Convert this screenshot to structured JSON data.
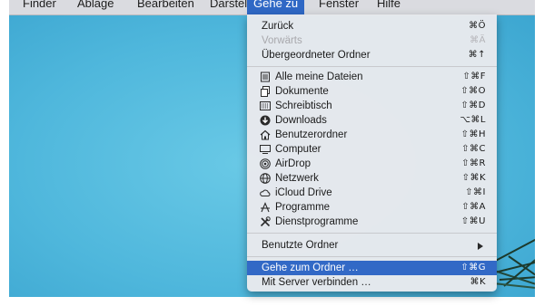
{
  "menubar": {
    "items": [
      {
        "label": "Finder"
      },
      {
        "label": "Ablage"
      },
      {
        "label": "Bearbeiten"
      },
      {
        "label": "Darstellung"
      },
      {
        "label": "Gehe zu"
      },
      {
        "label": "Fenster"
      },
      {
        "label": "Hilfe"
      }
    ],
    "active_index": 4
  },
  "menu": {
    "items": [
      {
        "label": "Zurück",
        "shortcut": "⌘Ö",
        "enabled": true
      },
      {
        "label": "Vorwärts",
        "shortcut": "⌘Ä",
        "enabled": false
      },
      {
        "label": "Übergeordneter Ordner",
        "shortcut": "⌘↑",
        "enabled": true
      },
      {
        "label": "Alle meine Dateien",
        "shortcut": "⇧⌘F",
        "icon": "all-files-icon",
        "enabled": true
      },
      {
        "label": "Dokumente",
        "shortcut": "⇧⌘O",
        "icon": "documents-icon",
        "enabled": true
      },
      {
        "label": "Schreibtisch",
        "shortcut": "⇧⌘D",
        "icon": "desktop-icon",
        "enabled": true
      },
      {
        "label": "Downloads",
        "shortcut": "⌥⌘L",
        "icon": "downloads-icon",
        "enabled": true
      },
      {
        "label": "Benutzerordner",
        "shortcut": "⇧⌘H",
        "icon": "home-icon",
        "enabled": true
      },
      {
        "label": "Computer",
        "shortcut": "⇧⌘C",
        "icon": "computer-icon",
        "enabled": true
      },
      {
        "label": "AirDrop",
        "shortcut": "⇧⌘R",
        "icon": "airdrop-icon",
        "enabled": true
      },
      {
        "label": "Netzwerk",
        "shortcut": "⇧⌘K",
        "icon": "network-icon",
        "enabled": true
      },
      {
        "label": "iCloud Drive",
        "shortcut": "⇧⌘I",
        "icon": "icloud-icon",
        "enabled": true
      },
      {
        "label": "Programme",
        "shortcut": "⇧⌘A",
        "icon": "applications-icon",
        "enabled": true
      },
      {
        "label": "Dienstprogramme",
        "shortcut": "⇧⌘U",
        "icon": "utilities-icon",
        "enabled": true
      },
      {
        "label": "Benutzte Ordner",
        "submenu": true,
        "enabled": true
      },
      {
        "label": "Gehe zum Ordner …",
        "shortcut": "⇧⌘G",
        "enabled": true,
        "highlighted": true
      },
      {
        "label": "Mit Server verbinden …",
        "shortcut": "⌘K",
        "enabled": true
      }
    ]
  },
  "colors": {
    "menu_highlight": "#3269c6",
    "desktop": "#4fb7dc"
  }
}
